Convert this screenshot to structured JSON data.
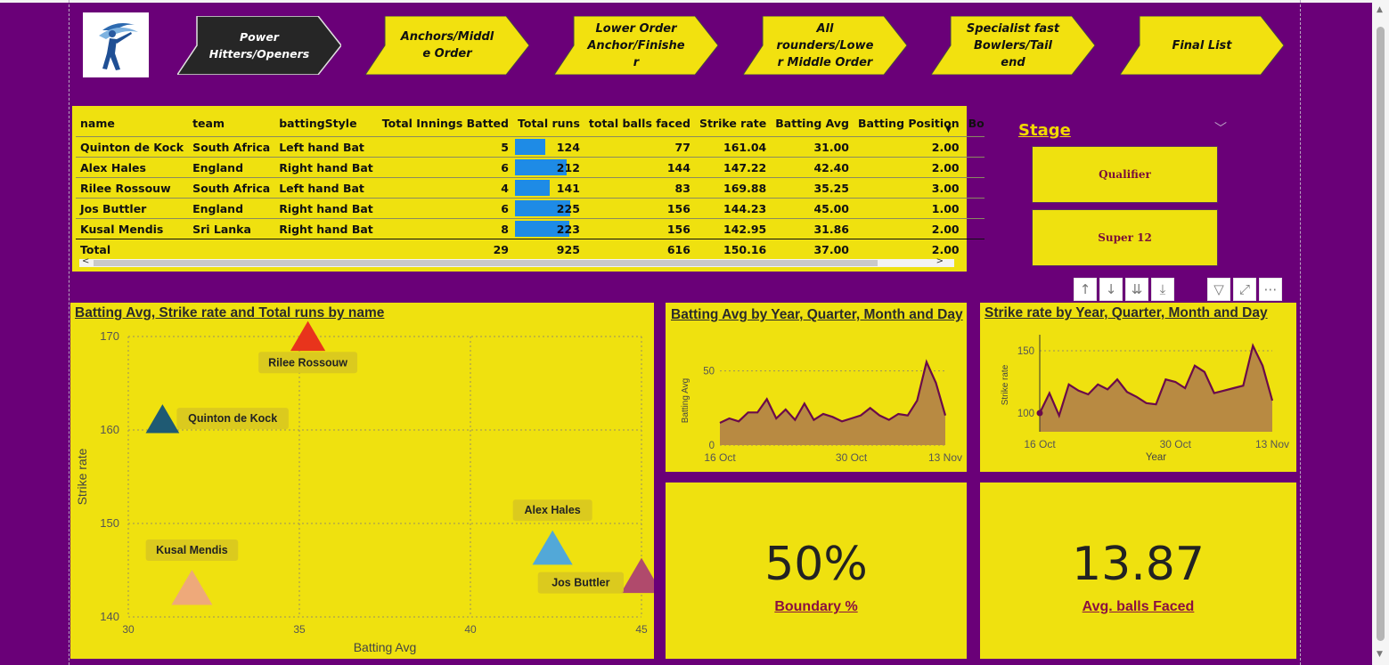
{
  "nav": {
    "tabs": [
      {
        "label": "Power\nHitters/Openers",
        "active": true
      },
      {
        "label": "Anchors/Middl\ne Order",
        "active": false
      },
      {
        "label": "Lower Order\nAnchor/Finishe\nr",
        "active": false
      },
      {
        "label": "All\nrounders/Lowe\nr Middle Order",
        "active": false
      },
      {
        "label": "Specialist fast\nBowlers/Tail\nend",
        "active": false
      },
      {
        "label": "Final List",
        "active": false
      }
    ]
  },
  "table": {
    "columns": [
      "name",
      "team",
      "battingStyle",
      "Total Innings Batted",
      "Total runs",
      "total balls faced",
      "Strike rate",
      "Batting Avg",
      "Batting Position",
      "Bo"
    ],
    "rows": [
      {
        "name": "Quinton de Kock",
        "team": "South Africa",
        "style": "Left hand Bat",
        "innings": "5",
        "runs": 124,
        "balls": "77",
        "sr": "161.04",
        "avg": "31.00",
        "pos": "2.00"
      },
      {
        "name": "Alex Hales",
        "team": "England",
        "style": "Right hand Bat",
        "innings": "6",
        "runs": 212,
        "balls": "144",
        "sr": "147.22",
        "avg": "42.40",
        "pos": "2.00"
      },
      {
        "name": "Rilee Rossouw",
        "team": "South Africa",
        "style": "Left hand Bat",
        "innings": "4",
        "runs": 141,
        "balls": "83",
        "sr": "169.88",
        "avg": "35.25",
        "pos": "3.00"
      },
      {
        "name": "Jos Buttler",
        "team": "England",
        "style": "Right hand Bat",
        "innings": "6",
        "runs": 225,
        "balls": "156",
        "sr": "144.23",
        "avg": "45.00",
        "pos": "1.00"
      },
      {
        "name": "Kusal Mendis",
        "team": "Sri Lanka",
        "style": "Right hand Bat",
        "innings": "8",
        "runs": 223,
        "balls": "156",
        "sr": "142.95",
        "avg": "31.86",
        "pos": "2.00"
      }
    ],
    "total": {
      "label": "Total",
      "innings": "29",
      "runs": "925",
      "balls": "616",
      "sr": "150.16",
      "avg": "37.00",
      "pos": "2.00"
    },
    "runs_bar_color": "#1e8be6"
  },
  "slicer": {
    "title": "Stage",
    "options": [
      "Qualifier",
      "Super 12"
    ]
  },
  "visual_toolbar": [
    "arrow-up-icon",
    "arrow-down-icon",
    "double-arrow-down-icon",
    "drill-down-icon",
    "filter-icon",
    "focus-mode-icon",
    "more-options-icon"
  ],
  "chart_data": [
    {
      "type": "scatter",
      "title": "Batting Avg, Strike rate and Total runs by name",
      "xlabel": "Batting Avg",
      "ylabel": "Strike rate",
      "xlim": [
        30,
        45
      ],
      "ylim": [
        140,
        170
      ],
      "xticks": [
        "30",
        "35",
        "40",
        "45"
      ],
      "yticks": [
        "140",
        "150",
        "160",
        "170"
      ],
      "marker": "triangle",
      "grid": true,
      "points": [
        {
          "name": "Quinton de Kock",
          "x": 31.0,
          "y": 161.04,
          "size": 124,
          "color": "#1f5a73"
        },
        {
          "name": "Alex Hales",
          "x": 42.4,
          "y": 147.22,
          "size": 212,
          "color": "#52a8d8"
        },
        {
          "name": "Rilee Rossouw",
          "x": 35.25,
          "y": 169.88,
          "size": 141,
          "color": "#e8341c"
        },
        {
          "name": "Jos Buttler",
          "x": 45.0,
          "y": 144.23,
          "size": 225,
          "color": "#b04a6c"
        },
        {
          "name": "Kusal Mendis",
          "x": 31.86,
          "y": 142.95,
          "size": 223,
          "color": "#eea97a"
        }
      ]
    },
    {
      "type": "area",
      "title": "Batting Avg by Year, Quarter, Month and Day",
      "xlabel": "",
      "ylabel": "Batting Avg",
      "ylim": [
        0,
        60
      ],
      "yticks": [
        "0",
        "50"
      ],
      "xticks": [
        "16 Oct",
        "30 Oct",
        "13 Nov"
      ],
      "x": [
        "16 Oct",
        "17 Oct",
        "18 Oct",
        "19 Oct",
        "20 Oct",
        "21 Oct",
        "22 Oct",
        "23 Oct",
        "24 Oct",
        "25 Oct",
        "26 Oct",
        "27 Oct",
        "28 Oct",
        "29 Oct",
        "30 Oct",
        "31 Oct",
        "1 Nov",
        "2 Nov",
        "3 Nov",
        "4 Nov",
        "5 Nov",
        "6 Nov",
        "9 Nov",
        "10 Nov",
        "13 Nov"
      ],
      "values": [
        15,
        18,
        16,
        22,
        22,
        31,
        18,
        24,
        17,
        28,
        17,
        21,
        19,
        16,
        18,
        20,
        25,
        20,
        17,
        21,
        20,
        30,
        56,
        42,
        20
      ],
      "line_color": "#6a0a4a",
      "fill_color": "#b88a42"
    },
    {
      "type": "area",
      "title": "Strike rate by Year, Quarter, Month and Day",
      "xlabel": "Year",
      "ylabel": "Strike rate",
      "ylim": [
        85,
        160
      ],
      "yticks": [
        "100",
        "150"
      ],
      "xticks": [
        "16 Oct",
        "30 Oct",
        "13 Nov"
      ],
      "x": [
        "16 Oct",
        "17 Oct",
        "18 Oct",
        "19 Oct",
        "20 Oct",
        "21 Oct",
        "22 Oct",
        "23 Oct",
        "24 Oct",
        "25 Oct",
        "26 Oct",
        "27 Oct",
        "28 Oct",
        "29 Oct",
        "30 Oct",
        "31 Oct",
        "1 Nov",
        "2 Nov",
        "3 Nov",
        "4 Nov",
        "5 Nov",
        "6 Nov",
        "9 Nov",
        "10 Nov",
        "13 Nov"
      ],
      "values": [
        100,
        116,
        98,
        123,
        118,
        115,
        123,
        119,
        127,
        117,
        113,
        108,
        107,
        127,
        125,
        120,
        138,
        133,
        116,
        118,
        120,
        122,
        154,
        138,
        110
      ],
      "line_color": "#6a0a4a",
      "fill_color": "#b88a42"
    }
  ],
  "kpis": [
    {
      "value": "50%",
      "label": "Boundary %"
    },
    {
      "value": "13.87",
      "label": "Avg. balls Faced"
    }
  ]
}
